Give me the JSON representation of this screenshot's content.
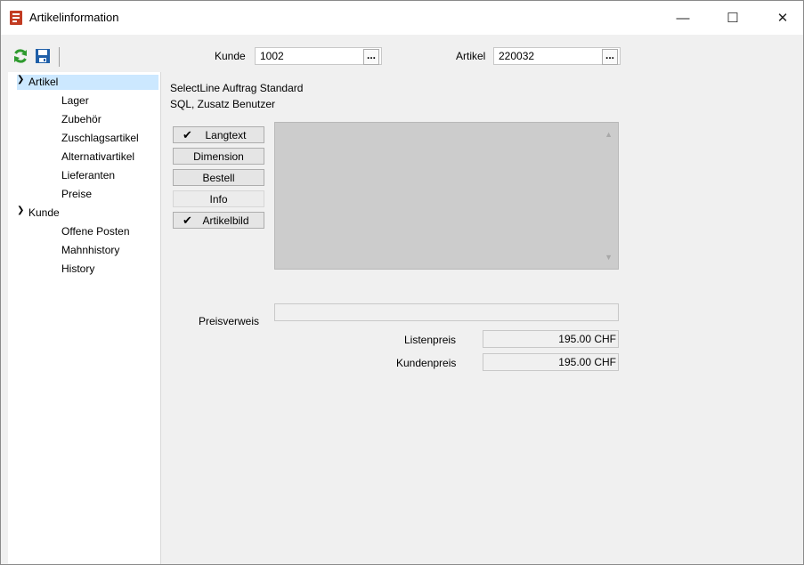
{
  "window": {
    "title": "Artikelinformation",
    "controls": {
      "minimize": "—",
      "maximize": "☐",
      "close": "✕"
    }
  },
  "toolbar": {
    "refresh_icon": "refresh-icon",
    "save_icon": "save-icon",
    "kunde_label": "Kunde",
    "kunde_value": "1002",
    "artikel_label": "Artikel",
    "artikel_value": "220032",
    "browse_label": "..."
  },
  "tree": {
    "artikel": {
      "label": "Artikel",
      "children": [
        "Lager",
        "Zubehör",
        "Zuschlagsartikel",
        "Alternativartikel",
        "Lieferanten",
        "Preise"
      ]
    },
    "kunde": {
      "label": "Kunde",
      "children": [
        "Offene Posten",
        "Mahnhistory",
        "History"
      ]
    }
  },
  "main": {
    "info_line1": "SelectLine Auftrag Standard",
    "info_line2": "SQL, Zusatz Benutzer",
    "buttons": {
      "langtext": "Langtext",
      "dimension": "Dimension",
      "bestell": "Bestell",
      "info": "Info",
      "artikelbild": "Artikelbild"
    },
    "checks": {
      "langtext": "✔",
      "artikelbild": "✔"
    },
    "preisverweis_label": "Preisverweis",
    "preisverweis_value": "",
    "listenpreis_label": "Listenpreis",
    "listenpreis_value": "195.00 CHF",
    "kundenpreis_label": "Kundenpreis",
    "kundenpreis_value": "195.00 CHF"
  },
  "colors": {
    "selection": "#cce8ff",
    "refresh": "#2e9a2e",
    "save": "#1f5fa8",
    "app_icon": "#c23b22"
  }
}
